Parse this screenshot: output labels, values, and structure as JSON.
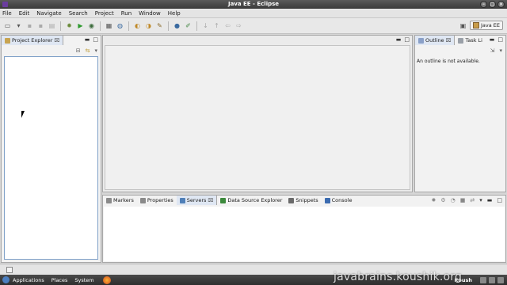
{
  "window": {
    "title": "Java EE - Eclipse"
  },
  "menu": [
    "File",
    "Edit",
    "Navigate",
    "Search",
    "Project",
    "Run",
    "Window",
    "Help"
  ],
  "perspective": {
    "label": "Java EE"
  },
  "project_explorer": {
    "tab_label": "Project Explorer",
    "close": "⌧"
  },
  "outline": {
    "tabs": [
      {
        "label": "Outline"
      },
      {
        "label": "Task Li"
      }
    ],
    "message": "An outline is not available."
  },
  "bottom_panel": {
    "tabs": [
      {
        "label": "Markers",
        "color": "#8a8a8a"
      },
      {
        "label": "Properties",
        "color": "#8a8a8a"
      },
      {
        "label": "Servers",
        "color": "#4f7fb8"
      },
      {
        "label": "Data Source Explorer",
        "color": "#3d8a3d"
      },
      {
        "label": "Snippets",
        "color": "#6a6a6a"
      },
      {
        "label": "Console",
        "color": "#3b6bb0"
      }
    ],
    "active_tab": "Servers"
  },
  "taskbar": {
    "items": [
      "Applications",
      "Places",
      "System"
    ],
    "user": "Koush"
  },
  "watermark": "javabrains.koushik.org",
  "colors": {
    "active_tab": "#dfe7f3",
    "selection_border": "#7fa0c8",
    "taskbar": "#3a3a3a"
  }
}
